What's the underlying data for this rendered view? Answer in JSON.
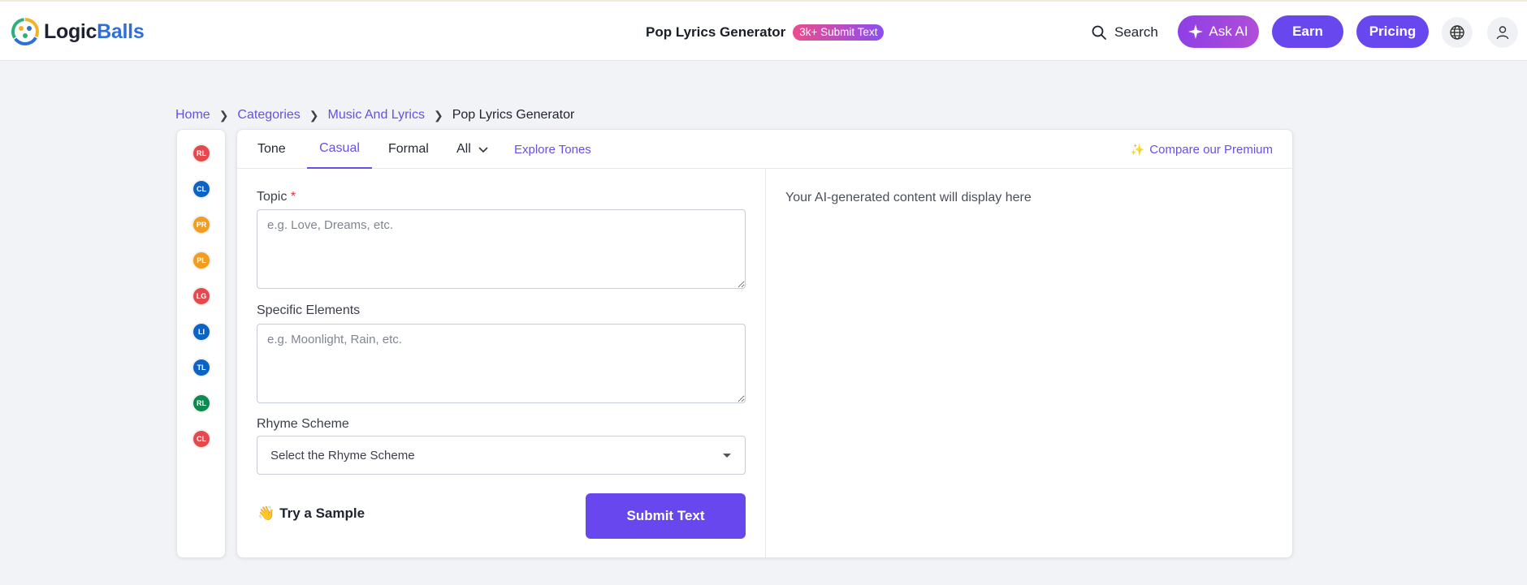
{
  "header": {
    "logo": {
      "word_a": "Logic",
      "word_b": "Balls"
    },
    "page_name": "Pop Lyrics Generator",
    "badge": "3k+ Submit Text",
    "search_label": "Search",
    "ask_ai_label": "Ask AI",
    "earn_label": "Earn",
    "pricing_label": "Pricing",
    "icons": [
      "search-icon",
      "sparkle-icon",
      "globe-icon",
      "user-icon"
    ]
  },
  "breadcrumb": {
    "items": [
      "Home",
      "Categories",
      "Music And Lyrics"
    ],
    "current": "Pop Lyrics Generator"
  },
  "rail": {
    "avatars": [
      {
        "initials": "RL",
        "color": "#e5484d"
      },
      {
        "initials": "CL",
        "color": "#0b63c4"
      },
      {
        "initials": "PR",
        "color": "#f19d1f"
      },
      {
        "initials": "PL",
        "color": "#f19d1f"
      },
      {
        "initials": "LG",
        "color": "#e5484d"
      },
      {
        "initials": "LI",
        "color": "#0b63c4"
      },
      {
        "initials": "TL",
        "color": "#0b63c4"
      },
      {
        "initials": "RL",
        "color": "#0d8a4f"
      },
      {
        "initials": "CL",
        "color": "#e5484d"
      }
    ]
  },
  "tabs": {
    "tone": "Tone",
    "casual": "Casual",
    "formal": "Formal",
    "all": "All",
    "explore": "Explore Tones",
    "compare": "Compare our Premium",
    "active": "Casual"
  },
  "form": {
    "topic_label": "Topic",
    "topic_required": "*",
    "topic_placeholder": "e.g. Love, Dreams, etc.",
    "topic_value": "",
    "elements_label": "Specific Elements",
    "elements_placeholder": "e.g. Moonlight, Rain, etc.",
    "elements_value": "",
    "rhyme_label": "Rhyme Scheme",
    "rhyme_selected": "Select the Rhyme Scheme",
    "sample_emoji": "👋",
    "sample_label": "Try a Sample",
    "submit_label": "Submit Text"
  },
  "output": {
    "message": "Your AI-generated content will display here"
  },
  "colors": {
    "accent": "#6847ee",
    "link": "#6750e6",
    "ask_ai_gradient": [
      "#8e3fe6",
      "#b04ed8"
    ],
    "badge_gradient": [
      "#ec4d8c",
      "#8b4ef0"
    ]
  }
}
